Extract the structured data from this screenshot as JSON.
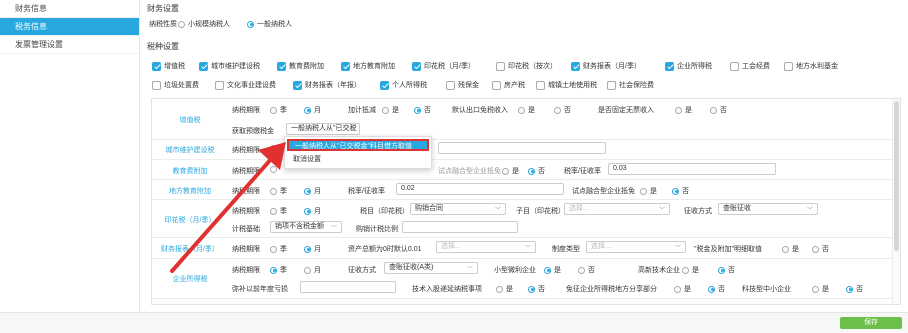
{
  "sidebar": {
    "items": [
      {
        "label": "财务信息",
        "active": false
      },
      {
        "label": "税务信息",
        "active": true
      },
      {
        "label": "发票管理设置",
        "active": false
      }
    ]
  },
  "finance": {
    "title": "财务设置",
    "taxpayer_label": "纳税性质",
    "taxpayer_options": [
      {
        "label": "小规模纳税人",
        "selected": false
      },
      {
        "label": "一般纳税人",
        "selected": true
      }
    ]
  },
  "taxes": {
    "title": "税种设置",
    "row1": [
      {
        "label": "增值税",
        "checked": true
      },
      {
        "label": "城市维护建设税",
        "checked": true
      },
      {
        "label": "教育费附加",
        "checked": true
      },
      {
        "label": "地方教育附加",
        "checked": true
      },
      {
        "label": "印花税（月/季）",
        "checked": true
      },
      {
        "label": "印花税（按次）",
        "checked": false
      },
      {
        "label": "财务报表（月/季）",
        "checked": true
      },
      {
        "label": "企业所得税",
        "checked": true
      },
      {
        "label": "工会经费",
        "checked": false
      },
      {
        "label": "地方水利基金",
        "checked": false
      }
    ],
    "row2": [
      {
        "label": "垃圾处置费",
        "checked": false
      },
      {
        "label": "文化事业建设费",
        "checked": false
      },
      {
        "label": "财务报表（年报）",
        "checked": true
      },
      {
        "label": "个人所得税",
        "checked": true
      },
      {
        "label": "残保金",
        "checked": false
      },
      {
        "label": "房产税",
        "checked": false
      },
      {
        "label": "城镇土地使用税",
        "checked": false
      },
      {
        "label": "社会保险费",
        "checked": false
      }
    ]
  },
  "rows": {
    "vat": {
      "label": "增值税",
      "period": "纳税期限",
      "quarter": "季",
      "month": "月",
      "plus": "加计抵减",
      "yes": "是",
      "no": "否",
      "export": "默认出口免税收入",
      "nodoc": "是否固定无票收入",
      "prepay_label": "获取预缴税金",
      "prepay_value": "一般纳税人从\"已交税"
    },
    "city": {
      "label": "城市维护建设税",
      "period": "纳税期限"
    },
    "edu": {
      "label": "教育费附加",
      "period": "纳税期限",
      "pilot": "试点融合型企业抵免",
      "yes": "是",
      "no": "否",
      "rate_label": "税率/征收率",
      "rate": "0.03"
    },
    "local_edu": {
      "label": "地方教育附加",
      "period": "纳税期限",
      "quarter": "季",
      "month": "月",
      "rate_label": "税率/征收率",
      "rate": "0.02",
      "pilot": "试点融合型企业抵免",
      "yes": "是",
      "no": "否"
    },
    "stamp": {
      "label": "印花税（月/季）",
      "period": "纳税期限",
      "quarter": "季",
      "month": "月",
      "item_label": "税目（印花税）",
      "item_value": "购销合同",
      "subitem_label": "子目（印花税）",
      "subitem_ph": "选择...",
      "method_label": "征收方式",
      "method_value": "查账征收",
      "basis_label": "计税基础",
      "basis_value": "销项不含税金额",
      "ratio_label": "购销计税比例"
    },
    "report": {
      "label": "财务报表（月/季）",
      "period": "纳税期限",
      "quarter": "季",
      "month": "月",
      "amount_label": "资产总额为0时默认0.01",
      "amount_ph": "选择...",
      "system_label": "制度类型",
      "system_ph": "选择...",
      "detail_label": "\"税金及附加\"明细取值",
      "yes": "是",
      "no": "否"
    },
    "cit": {
      "label": "企业所得税",
      "period": "纳税期限",
      "quarter": "季",
      "month": "月",
      "method_label": "征收方式",
      "method_value": "查账征收(A类)",
      "small_label": "小型微利企业",
      "hightech_label": "高新技术企业",
      "makeup_label": "弥补以前年度亏损",
      "tech_label": "技术入股递延纳税事项",
      "share_label": "免征企业所得税地方分享部分",
      "sme_label": "科技型中小企业",
      "yes": "是",
      "no": "否"
    }
  },
  "dropdown": {
    "options": [
      "一般纳税人从\"已交税金\"科目借方取值",
      "取消设置"
    ]
  },
  "footer": {
    "save_label": "保存"
  },
  "colors": {
    "accent": "#29a8e0",
    "save": "#6cc04a",
    "arrow": "#e03030"
  }
}
